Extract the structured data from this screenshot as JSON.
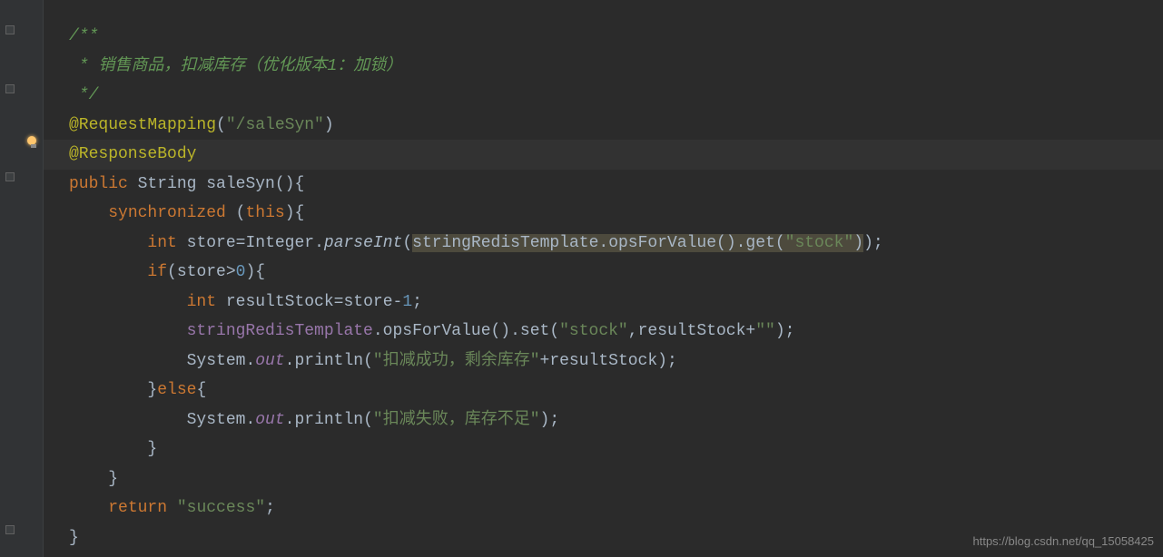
{
  "code": {
    "comment_start": "/**",
    "comment_body": " * 销售商品，扣减库存（优化版本1：加锁）",
    "comment_end": " */",
    "anno_request": "@RequestMapping",
    "anno_request_path": "\"/saleSyn\"",
    "anno_response": "@ResponseBody",
    "kw_public": "public",
    "type_string": "String",
    "method_name": "saleSyn",
    "kw_synchronized": "synchronized",
    "kw_this": "this",
    "kw_int": "int",
    "var_store": "store",
    "class_integer": "Integer",
    "method_parseint": "parseInt",
    "field_template": "stringRedisTemplate",
    "method_opsforvalue": "opsForValue",
    "method_get": "get",
    "str_stock": "\"stock\"",
    "kw_if": "if",
    "num_zero": "0",
    "var_resultstock": "resultStock",
    "num_one": "1",
    "method_set": "set",
    "str_empty": "\"\"",
    "class_system": "System",
    "field_out": "out",
    "method_println": "println",
    "str_success_msg": "\"扣减成功，剩余库存\"",
    "kw_else": "else",
    "str_fail_msg": "\"扣减失败，库存不足\"",
    "kw_return": "return",
    "str_return_val": "\"success\""
  },
  "watermark": "https://blog.csdn.net/qq_15058425"
}
